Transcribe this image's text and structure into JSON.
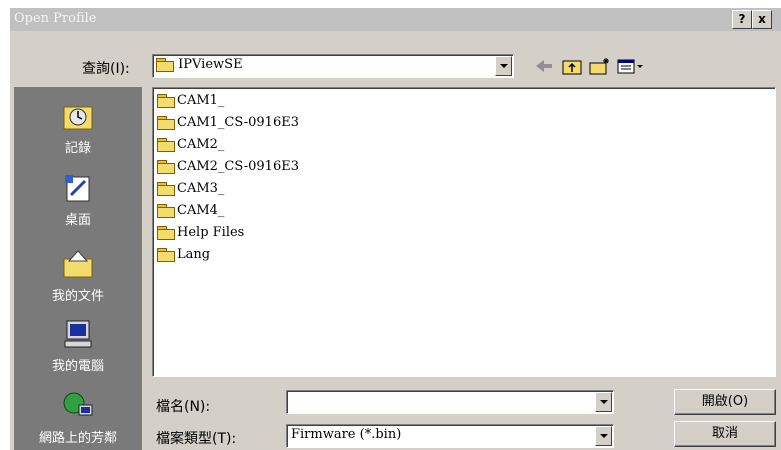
{
  "window": {
    "title": "Open Profile",
    "help_label": "?",
    "close_label": "x"
  },
  "lookin": {
    "label": "查詢(I):",
    "value": "IPViewSE"
  },
  "files": [
    {
      "name": "CAM1_"
    },
    {
      "name": "CAM1_CS-0916E3"
    },
    {
      "name": "CAM2_"
    },
    {
      "name": "CAM2_CS-0916E3"
    },
    {
      "name": "CAM3_"
    },
    {
      "name": "CAM4_"
    },
    {
      "name": "Help Files"
    },
    {
      "name": "Lang"
    }
  ],
  "places": [
    {
      "label": "記錄",
      "icon": "history-icon"
    },
    {
      "label": "桌面",
      "icon": "desktop-icon"
    },
    {
      "label": "我的文件",
      "icon": "my-documents-icon"
    },
    {
      "label": "我的電腦",
      "icon": "my-computer-icon"
    },
    {
      "label": "網路上的芳鄰",
      "icon": "network-icon"
    }
  ],
  "filename": {
    "label": "檔名(N):",
    "value": ""
  },
  "filetype": {
    "label": "檔案類型(T):",
    "value": "Firmware (*.bin)"
  },
  "buttons": {
    "open": "開啟(O)",
    "cancel": "取消"
  }
}
